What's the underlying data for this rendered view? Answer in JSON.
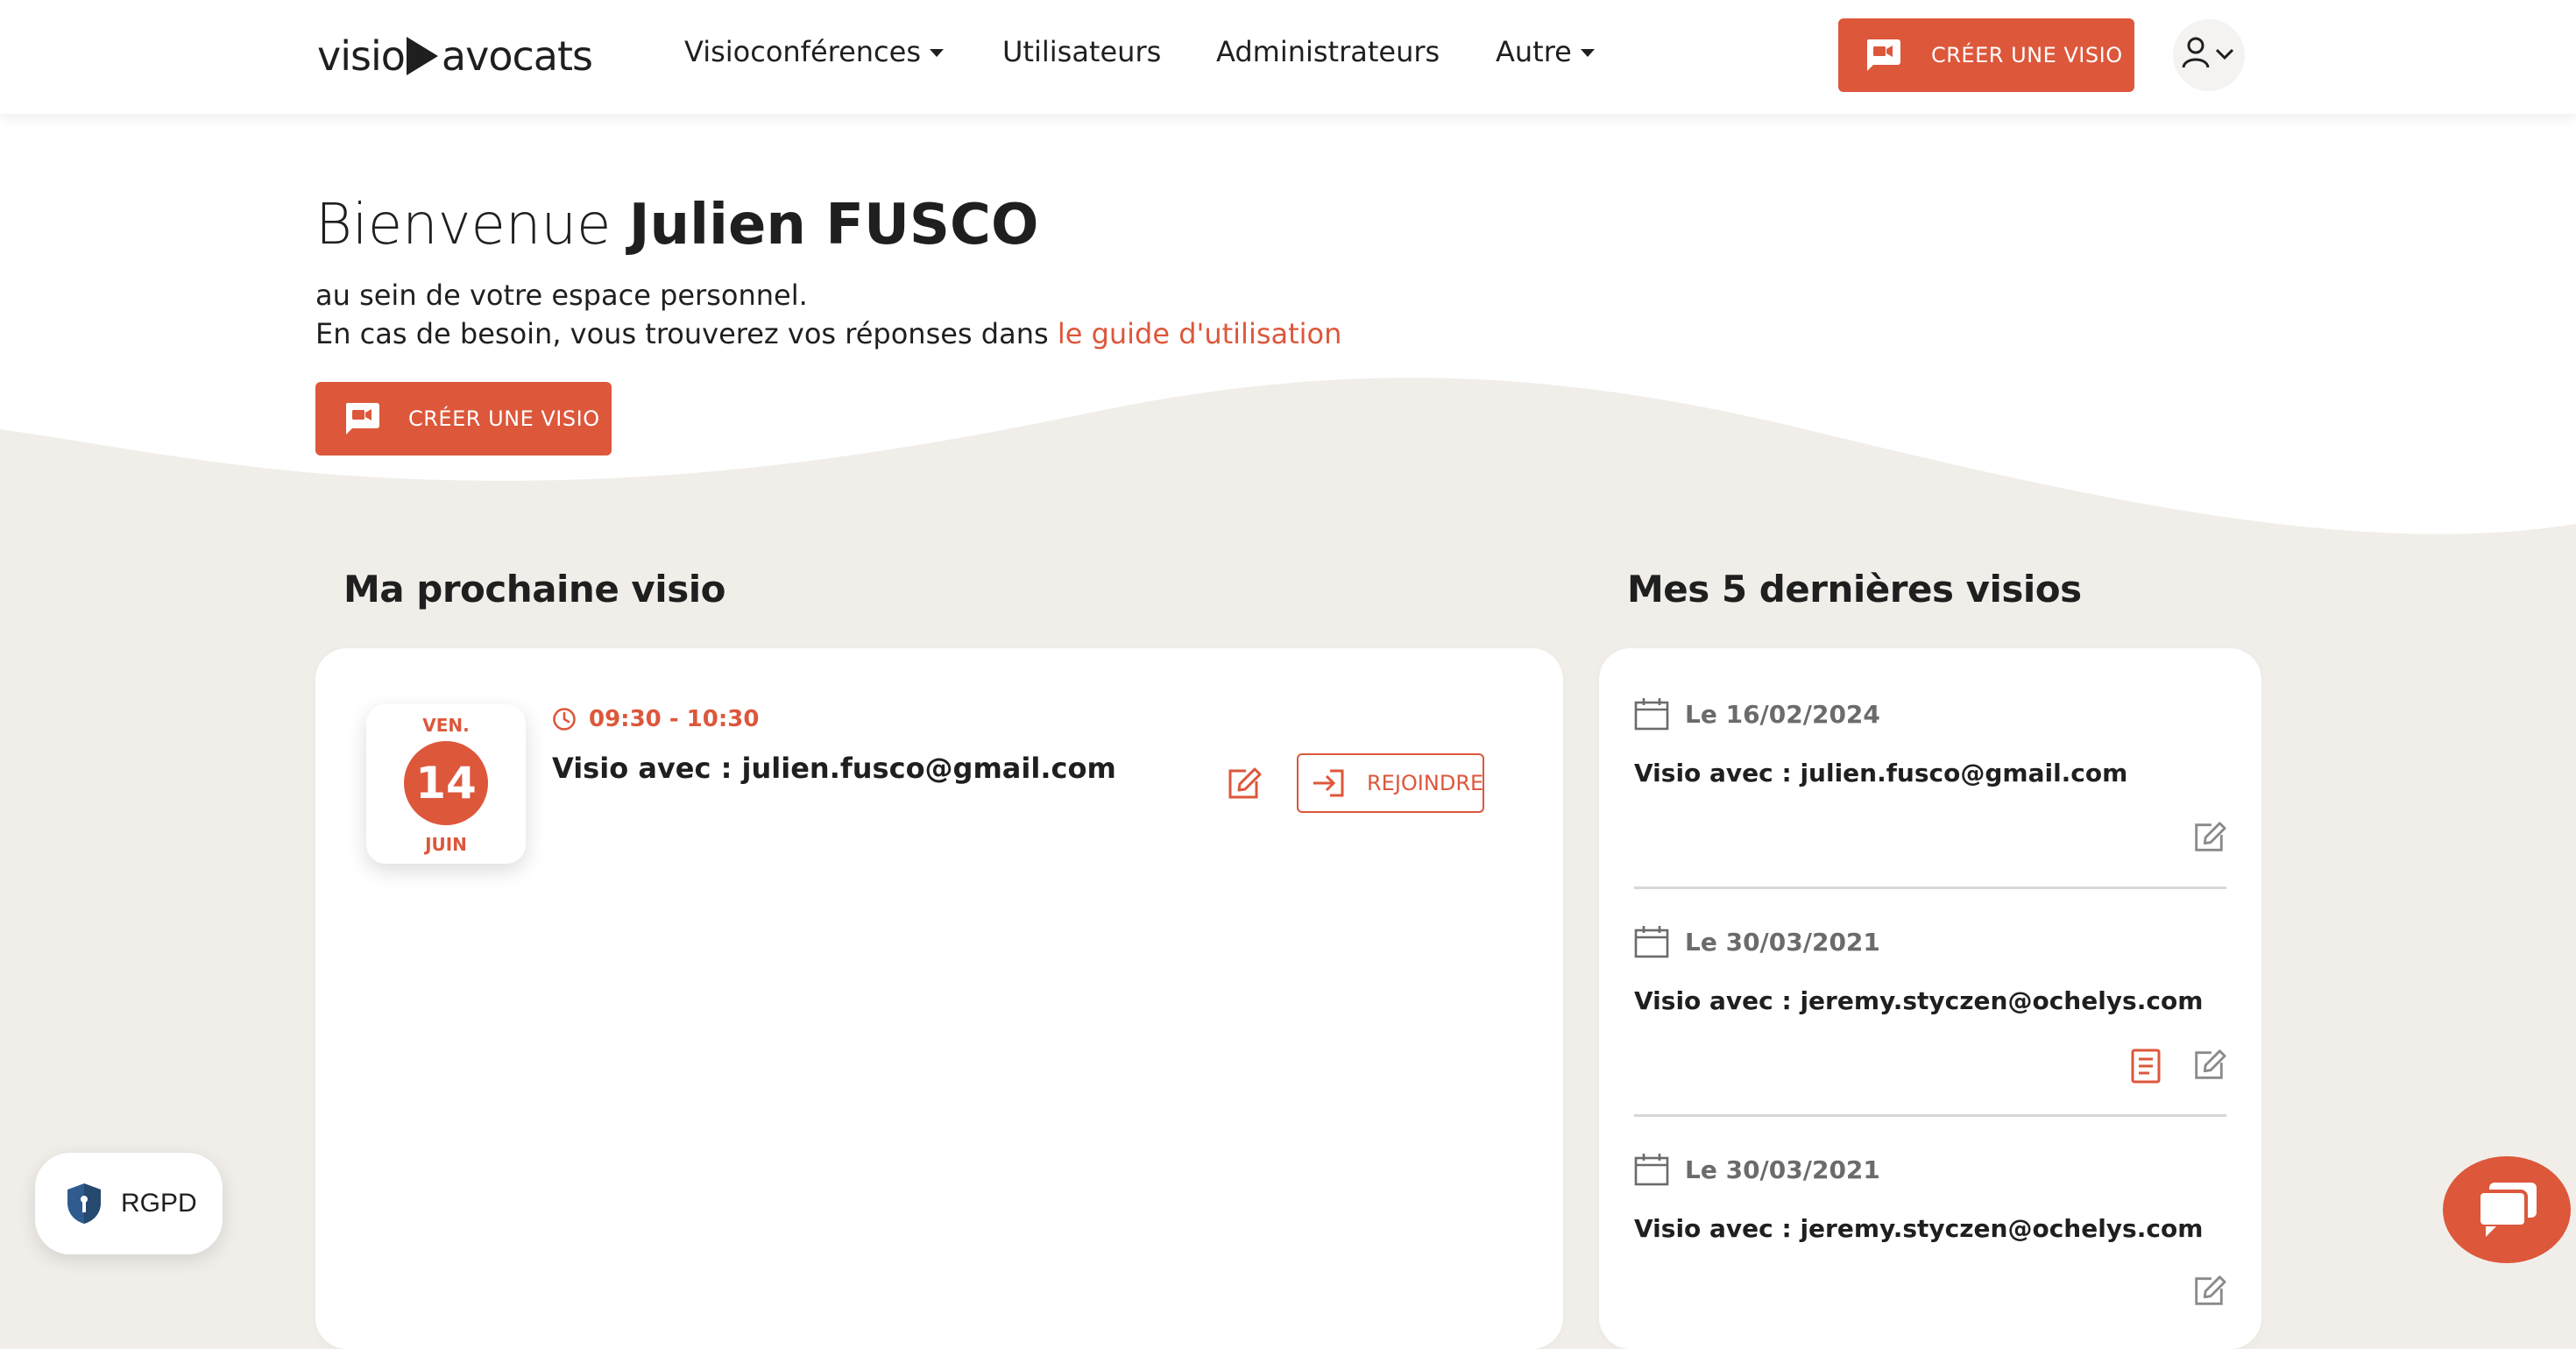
{
  "brand": {
    "logo_left": "visio",
    "logo_right": "avocats"
  },
  "nav": {
    "items": [
      {
        "label": "Visioconférences",
        "dropdown": true
      },
      {
        "label": "Utilisateurs",
        "dropdown": false
      },
      {
        "label": "Administrateurs",
        "dropdown": false
      },
      {
        "label": "Autre",
        "dropdown": true
      }
    ],
    "create_button": "CRÉER UNE VISIO",
    "user_icon": "user-icon"
  },
  "welcome": {
    "greeting": "Bienvenue",
    "name": "Julien FUSCO",
    "subtitle": "au sein de votre espace personnel.",
    "help_text": "En cas de besoin, vous trouverez vos réponses dans",
    "help_link": "le guide d'utilisation",
    "create_button": "CRÉER UNE VISIO"
  },
  "next_visio": {
    "title": "Ma prochaine visio",
    "day_of_week": "VEN.",
    "day": "14",
    "month": "JUIN",
    "time": "09:30 - 10:30",
    "label": "Visio avec : julien.fusco@gmail.com",
    "join_button": "REJOINDRE"
  },
  "recent": {
    "title": "Mes 5 dernières visios",
    "items": [
      {
        "date": "Le 16/02/2024",
        "label": "Visio avec : julien.fusco@gmail.com",
        "has_report": false
      },
      {
        "date": "Le 30/03/2021",
        "label": "Visio avec : jeremy.styczen@ochelys.com",
        "has_report": true
      },
      {
        "date": "Le 30/03/2021",
        "label": "Visio avec : jeremy.styczen@ochelys.com",
        "has_report": false
      }
    ]
  },
  "rgpd": {
    "label": "RGPD"
  },
  "colors": {
    "accent": "#dd573b",
    "background": "#f1eeea",
    "text": "#1f1f1f"
  }
}
